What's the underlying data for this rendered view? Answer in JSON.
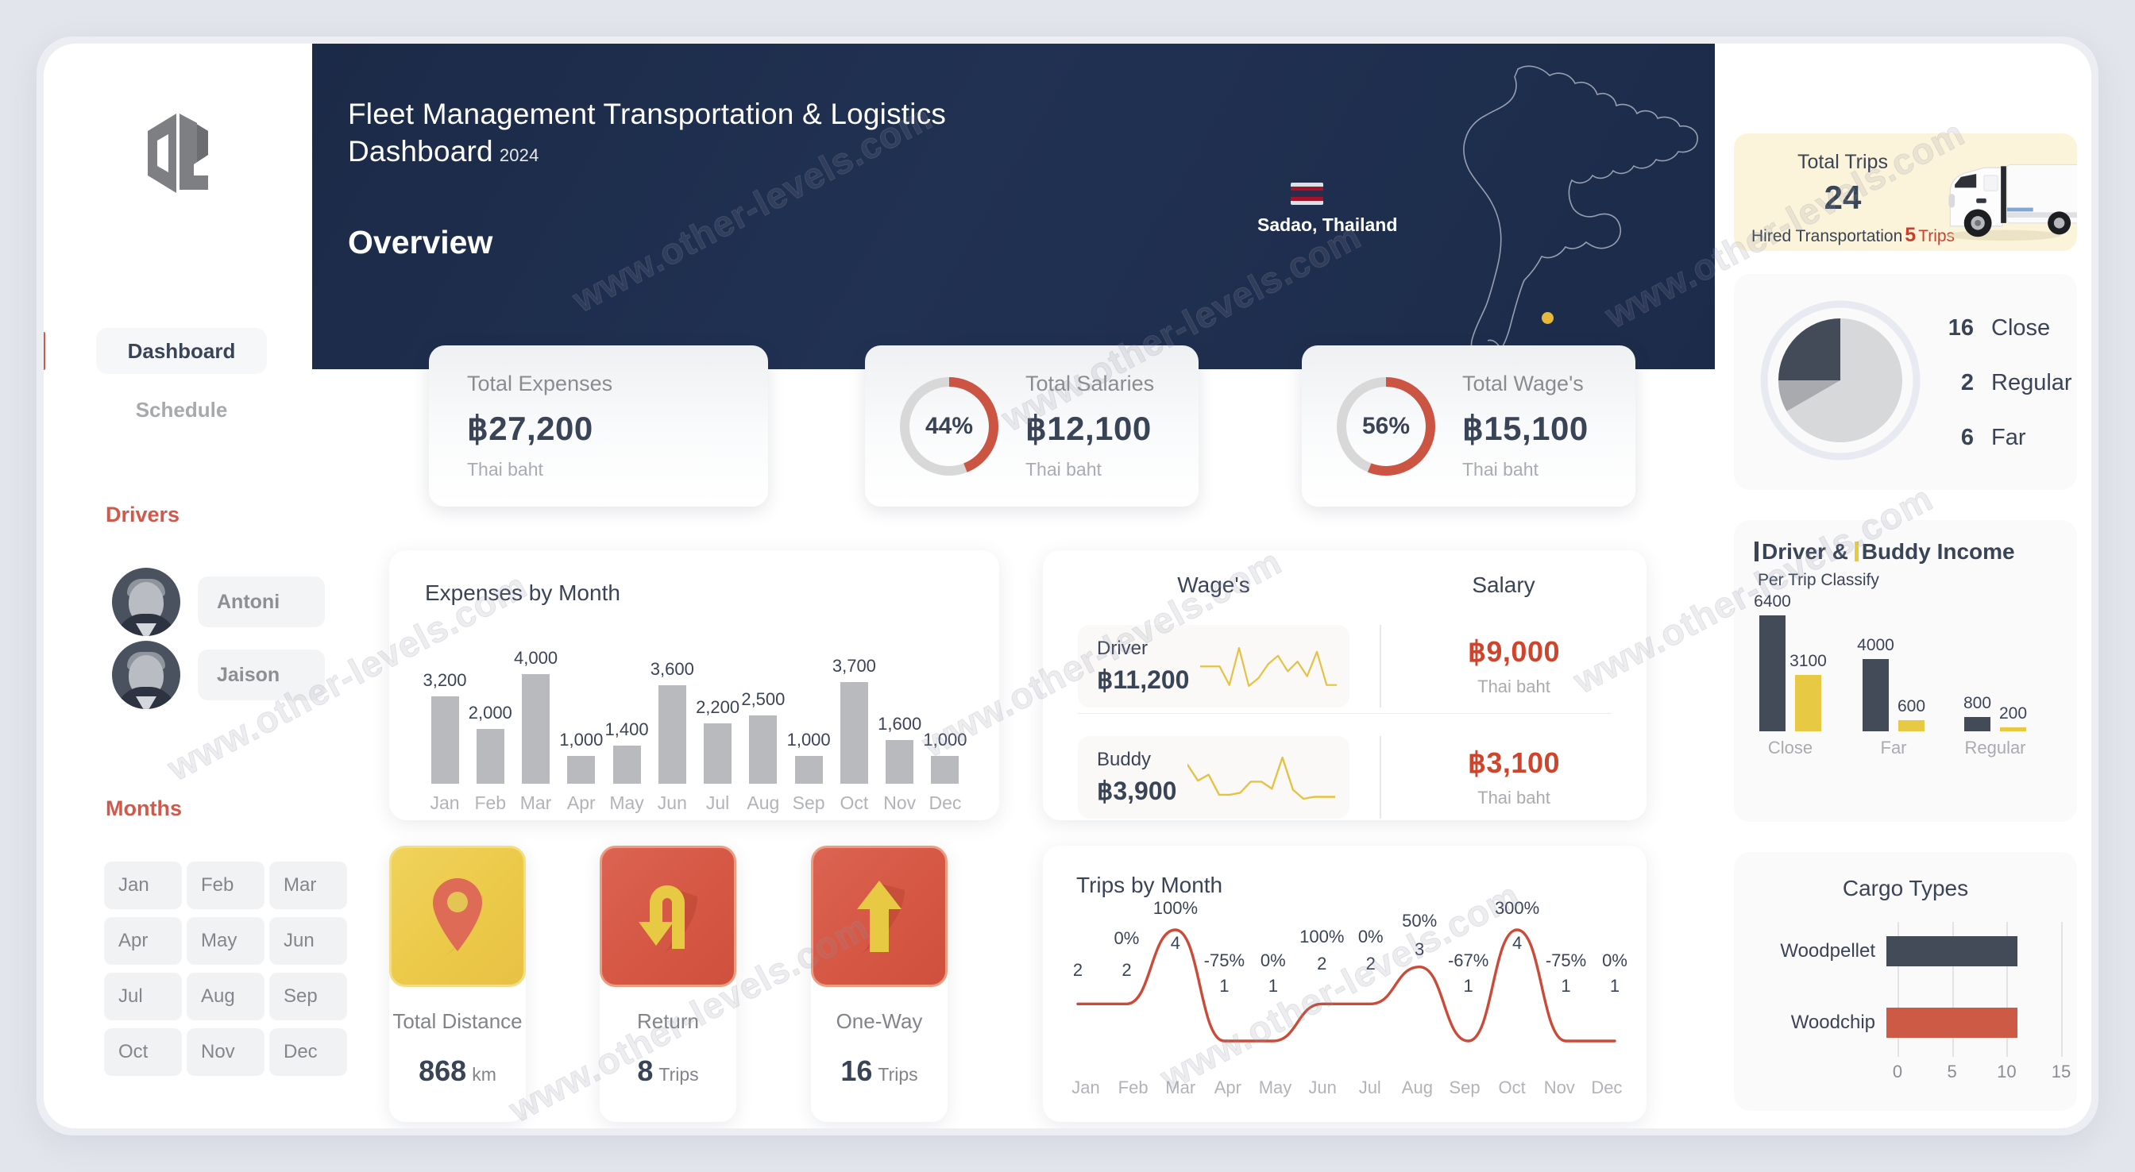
{
  "sidebar": {
    "logo_icon": "dl-monogram-logo",
    "nav": [
      {
        "label": "Dashboard",
        "active": true
      },
      {
        "label": "Schedule",
        "active": false
      }
    ],
    "drivers_heading": "Drivers",
    "drivers": [
      {
        "name": "Antoni"
      },
      {
        "name": "Jaison"
      }
    ],
    "months_heading": "Months",
    "months": [
      "Jan",
      "Feb",
      "Mar",
      "Apr",
      "May",
      "Jun",
      "Jul",
      "Aug",
      "Sep",
      "Oct",
      "Nov",
      "Dec"
    ]
  },
  "header": {
    "title": "Fleet Management Transportation & Logistics Dashboard",
    "year": "2024",
    "section": "Overview",
    "location": "Sadao, Thailand",
    "flag_icon": "thailand-flag-icon",
    "map_icon": "thailand-map-outline"
  },
  "kpis": [
    {
      "label": "Total Expenses",
      "value": "฿27,200",
      "unit": "Thai baht",
      "percent": null
    },
    {
      "label": "Total Salaries",
      "value": "฿12,100",
      "unit": "Thai baht",
      "percent": "44%",
      "percent_num": 44
    },
    {
      "label": "Total Wage's",
      "value": "฿15,100",
      "unit": "Thai baht",
      "percent": "56%",
      "percent_num": 56
    }
  ],
  "wages": {
    "header_wages": "Wage's",
    "header_salary": "Salary",
    "rows": [
      {
        "who": "Driver",
        "amount": "฿11,200",
        "salary": "฿9,000",
        "unit": "Thai baht",
        "spark": [
          50,
          50,
          50,
          12,
          88,
          10,
          26,
          55,
          72,
          40,
          60,
          30,
          80,
          12,
          12
        ]
      },
      {
        "who": "Buddy",
        "amount": "฿3,900",
        "salary": "฿3,100",
        "unit": "Thai baht",
        "spark": [
          78,
          46,
          58,
          18,
          18,
          22,
          44,
          44,
          30,
          92,
          28,
          10,
          14,
          14,
          14
        ]
      }
    ]
  },
  "tiles": [
    {
      "name": "Total Distance",
      "value": "868",
      "unit": "km",
      "icon": "map-pin-icon",
      "theme": "yellow"
    },
    {
      "name": "Return",
      "value": "8",
      "unit": "Trips",
      "icon": "u-turn-arrow-icon",
      "theme": "red"
    },
    {
      "name": "One-Way",
      "value": "16",
      "unit": "Trips",
      "icon": "up-arrow-icon",
      "theme": "red"
    }
  ],
  "right": {
    "total_trips_label": "Total Trips",
    "total_trips_value": "24",
    "hired_label": "Hired Transportation",
    "hired_value": "5",
    "hired_unit": "Trips",
    "truck_icon": "semi-truck-icon",
    "income_title_a": "Driver &",
    "income_title_b": "Buddy Income",
    "income_subtitle": "Per Trip Classify",
    "cargo_title": "Cargo Types"
  },
  "colors": {
    "accent_red": "#d1594a",
    "salary_red": "#d1442c",
    "navy": "#3a4457",
    "yellow": "#e8c944",
    "header_navy": "#1e2d4d",
    "bar_gray": "#b9babd",
    "pie_light": "#d7d8da",
    "pie_dark": "#434b58",
    "pie_mid": "#a8aaad"
  },
  "chart_data": [
    {
      "type": "bar",
      "title": "Expenses by Month",
      "categories": [
        "Jan",
        "Feb",
        "Mar",
        "Apr",
        "May",
        "Jun",
        "Jul",
        "Aug",
        "Sep",
        "Oct",
        "Nov",
        "Dec"
      ],
      "values": [
        3200,
        2000,
        4000,
        1000,
        1400,
        3600,
        2200,
        2500,
        1000,
        3700,
        1600,
        1000
      ],
      "value_labels": [
        "3,200",
        "2,000",
        "4,000",
        "1,000",
        "1,400",
        "3,600",
        "2,200",
        "2,500",
        "1,000",
        "3,700",
        "1,600",
        "1,000"
      ],
      "xlabel": "",
      "ylabel": "",
      "ylim": [
        0,
        4000
      ],
      "grid": false,
      "legend": "none",
      "series_color": "#b9babd"
    },
    {
      "type": "line",
      "title": "Trips by Month",
      "categories": [
        "Jan",
        "Feb",
        "Mar",
        "Apr",
        "May",
        "Jun",
        "Jul",
        "Aug",
        "Sep",
        "Oct",
        "Nov",
        "Dec"
      ],
      "values": [
        2,
        2,
        4,
        1,
        1,
        2,
        2,
        3,
        1,
        4,
        1,
        1
      ],
      "count_labels": [
        "2",
        "2",
        "4",
        "1",
        "1",
        "2",
        "2",
        "3",
        "1",
        "4",
        "1",
        "1"
      ],
      "pct_labels": [
        "",
        "0%",
        "100%",
        "-75%",
        "0%",
        "100%",
        "0%",
        "50%",
        "-67%",
        "300%",
        "-75%",
        "0%"
      ],
      "ylim": [
        0,
        4
      ],
      "grid": false,
      "legend": "none",
      "series_color": "#cc4b38"
    },
    {
      "type": "pie",
      "title": "",
      "labels": [
        "Close",
        "Regular",
        "Far"
      ],
      "values": [
        16,
        2,
        6
      ],
      "colors": [
        "#d7d8da",
        "#a8aaad",
        "#434b58"
      ],
      "legend": "right"
    },
    {
      "type": "bar",
      "title": "Driver & Buddy Income",
      "subtitle": "Per Trip Classify",
      "categories": [
        "Close",
        "Far",
        "Regular"
      ],
      "series": [
        {
          "name": "Driver",
          "values": [
            6400,
            4000,
            800
          ],
          "color": "#434b58"
        },
        {
          "name": "Buddy",
          "values": [
            3100,
            600,
            200
          ],
          "color": "#e8c944"
        }
      ],
      "value_labels": [
        [
          "6400",
          "3100"
        ],
        [
          "4000",
          "600"
        ],
        [
          "800",
          "200"
        ]
      ],
      "ylim": [
        0,
        6400
      ],
      "grid": false,
      "legend": "none"
    },
    {
      "type": "bar",
      "title": "Cargo Types",
      "orientation": "horizontal",
      "categories": [
        "Woodpellet",
        "Woodchip"
      ],
      "values": [
        12,
        12
      ],
      "colors": [
        "#434b58",
        "#cc5a45"
      ],
      "xticks": [
        "0",
        "5",
        "10",
        "15"
      ],
      "xlim": [
        0,
        15
      ],
      "grid": true,
      "legend": "none"
    }
  ],
  "watermarks": [
    "www.other-levels.com",
    "www.other-levels.com",
    "www.other-levels.com",
    "www.other-levels.com",
    "www.other-levels.com",
    "www.other-levels.com",
    "www.other-levels.com",
    "www.other-levels.com"
  ]
}
